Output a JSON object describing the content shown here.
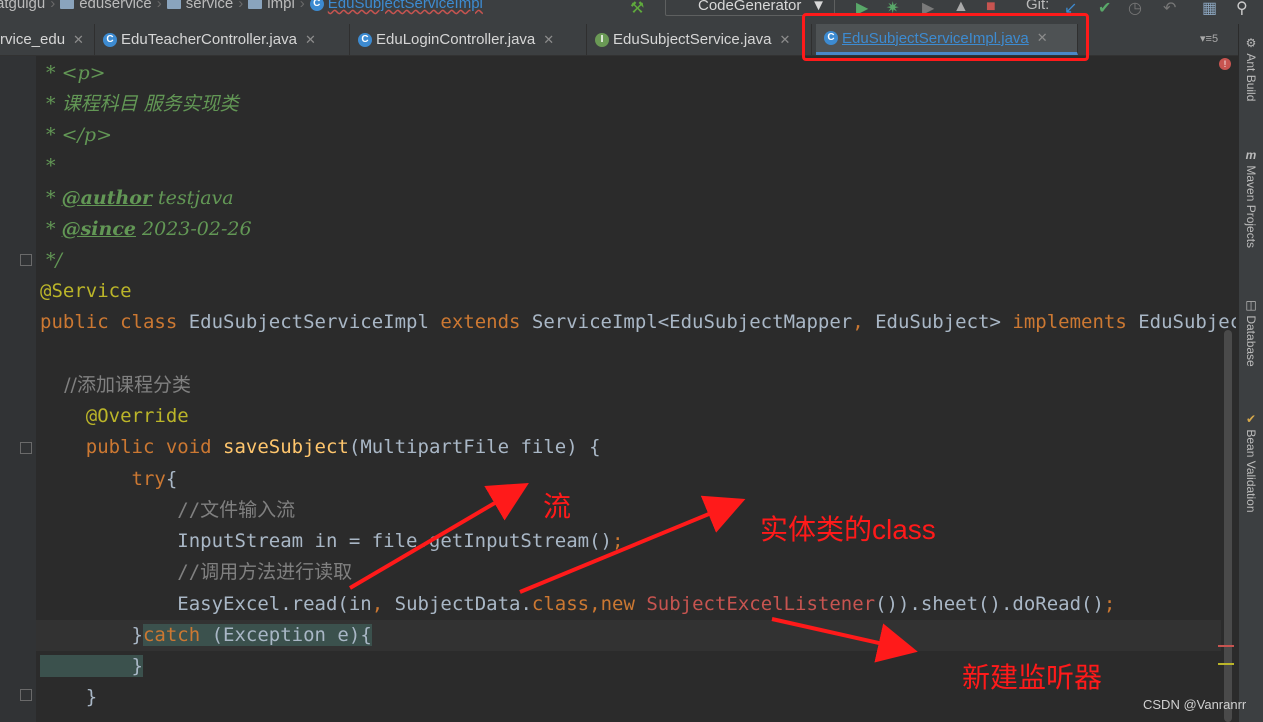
{
  "breadcrumb": [
    "atguigu",
    "eduservice",
    "service",
    "impl",
    "EduSubjectServiceImpl"
  ],
  "toolbar": {
    "run_config": "CodeGenerator",
    "git_label": "Git:"
  },
  "tabs": [
    {
      "label": "rvice_edu",
      "icon": "none"
    },
    {
      "label": "EduTeacherController.java",
      "icon": "class-icon"
    },
    {
      "label": "EduLoginController.java",
      "icon": "class-icon"
    },
    {
      "label": "EduSubjectService.java",
      "icon": "interface-icon"
    },
    {
      "label": "EduSubjectServiceImpl.java",
      "icon": "class-icon",
      "active": true
    }
  ],
  "tab_overflow": "5",
  "side_tools": [
    "Ant Build",
    "Maven Projects",
    "Database",
    "Bean Validation"
  ],
  "code": {
    "l1": " * <p>",
    "l2": " * 课程科目 服务实现类",
    "l3": " * </p>",
    "l4": " *",
    "l5_pre": " * ",
    "l5_tag": "@author",
    "l5_val": " testjava",
    "l6_pre": " * ",
    "l6_tag": "@since",
    "l6_val": " 2023-02-26",
    "l7": " */",
    "l8": "@Service",
    "l9_kw1": "public class ",
    "l9_name": "EduSubjectServiceImpl ",
    "l9_kw2": "extends ",
    "l9_sup": "ServiceImpl<EduSubjectMapper",
    "l9_comma": ", ",
    "l9_sup2": "EduSubject> ",
    "l9_kw3": "implements ",
    "l9_iface": "EduSubjectSer",
    "l11": "    //添加课程分类",
    "l12": "    @Override",
    "l13_kw": "    public void ",
    "l13_fn": "saveSubject",
    "l13_rest": "(MultipartFile file) {",
    "l14_kw": "        try",
    "l14_rest": "{",
    "l15": "            //文件输入流",
    "l16_a": "            InputStream in = file.getInputStream()",
    "l16_b": ";",
    "l17": "            //调用方法进行读取",
    "l18_a": "            EasyExcel.read(in",
    "l18_b": ", ",
    "l18_c": "SubjectData.",
    "l18_d": "class",
    "l18_e": ",",
    "l18_f": "new ",
    "l18_g": "SubjectExcelListener",
    "l18_h": "()).sheet().doRead()",
    "l18_i": ";",
    "l19_a": "        }",
    "l19_kw": "catch ",
    "l19_b": "(Exception e)",
    "l19_c": "{",
    "l20": "        }",
    "l21": "    }"
  },
  "annotations": {
    "stream": "流",
    "entity_class": "实体类的class",
    "new_listener": "新建监听器"
  },
  "watermark": "CSDN @Vanranrr",
  "colors": {
    "highlight_box": "#ff1a1a",
    "active_tab_accent": "#4a88c7"
  }
}
